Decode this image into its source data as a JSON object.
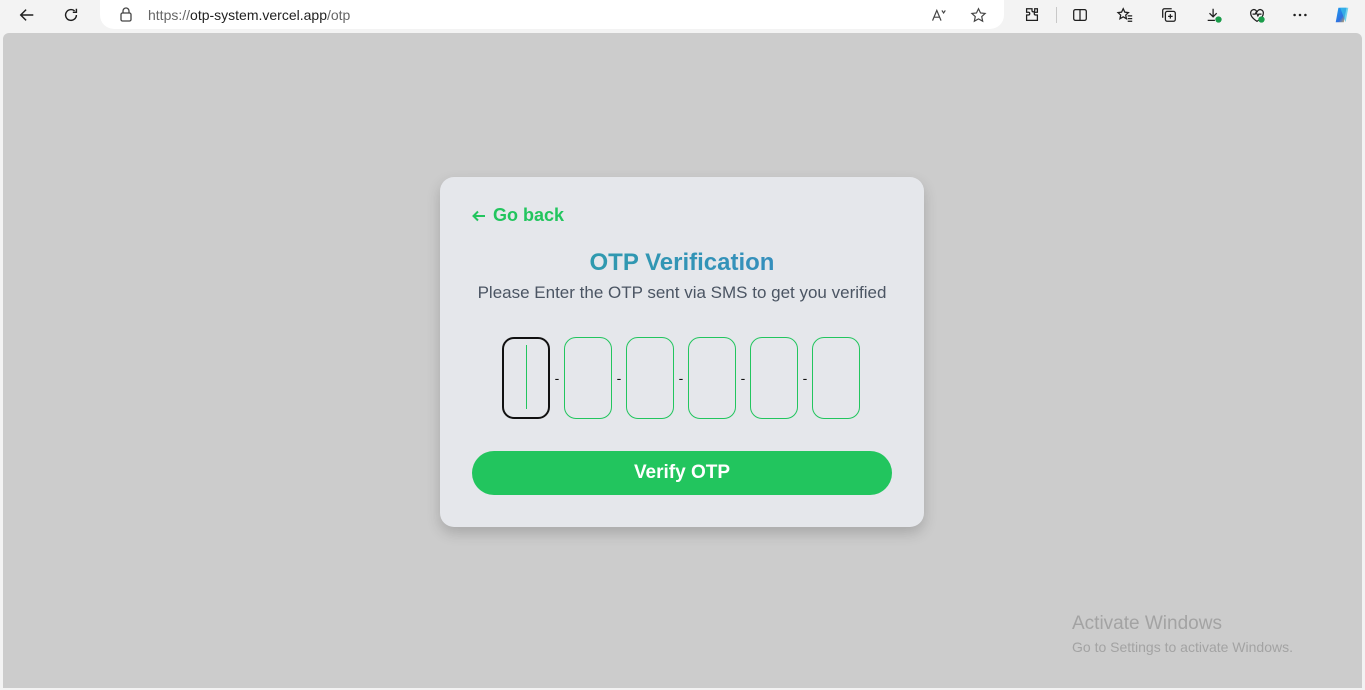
{
  "browser": {
    "url_prefix": "https://",
    "url_host": "otp-system.vercel.app",
    "url_path": "/otp",
    "icons": [
      "back-icon",
      "refresh-icon",
      "lock-icon",
      "read-aloud-icon",
      "favorite-star-icon",
      "extensions-icon",
      "split-screen-icon",
      "favorites-icon",
      "collections-icon",
      "downloads-icon",
      "browser-essentials-icon",
      "more-icon",
      "copilot-icon"
    ]
  },
  "card": {
    "back_label": "Go back",
    "title": "OTP Verification",
    "subtitle": "Please Enter the OTP sent via SMS to get you verified",
    "separator": "-",
    "otp_digits": [
      "",
      "",
      "",
      "",
      "",
      ""
    ],
    "verify_label": "Verify OTP"
  },
  "watermark": {
    "line1": "Activate Windows",
    "line2": "Go to Settings to activate Windows."
  },
  "colors": {
    "accent": "#22c55e",
    "title_gradient_start": "#2aa3a3",
    "title_gradient_end": "#3a86c8",
    "card_bg": "#e5e7eb",
    "page_bg": "#cccccc"
  }
}
